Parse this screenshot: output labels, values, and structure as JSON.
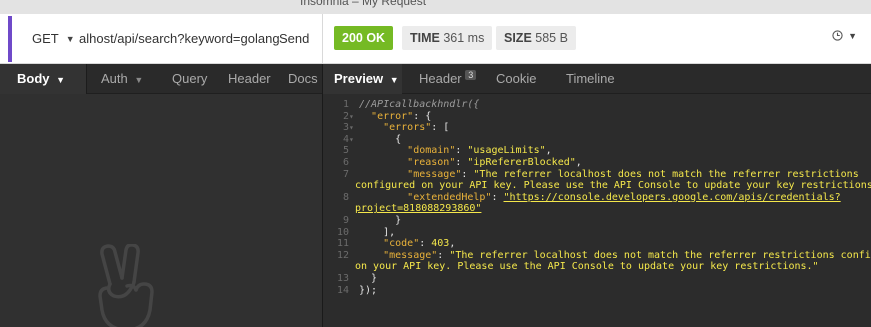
{
  "window": {
    "title": "Insomnia – My Request"
  },
  "request": {
    "method": "GET",
    "url": "alhost/api/search?keyword=golang",
    "send_label": "Send"
  },
  "response": {
    "status": "200 OK",
    "time_label": "TIME",
    "time_value": "361 ms",
    "size_label": "SIZE",
    "size_value": "585 B",
    "history_icon": "clock-icon"
  },
  "request_tabs": [
    "Body",
    "Auth",
    "Query",
    "Header",
    "Docs"
  ],
  "response_tabs": {
    "preview": "Preview",
    "header": "Header",
    "header_count": "3",
    "cookie": "Cookie",
    "timeline": "Timeline"
  },
  "code": {
    "line_numbers": [
      "1",
      "2",
      "3",
      "4",
      "5",
      "6",
      "7",
      "8",
      "9",
      "10",
      "11",
      "12",
      "13",
      "14"
    ],
    "comment": "//APIcallbackhndlr({",
    "k_error": "\"error\"",
    "k_errors": "\"errors\"",
    "k_domain": "\"domain\"",
    "v_domain": "\"usageLimits\"",
    "k_reason": "\"reason\"",
    "v_reason": "\"ipRefererBlocked\"",
    "k_message": "\"message\"",
    "v_message_1": "\"The referrer localhost does not match the referrer restrictions",
    "v_message_2": "configured on your API key. Please use the API Console to update your key restrictions.\"",
    "k_help": "\"extendedHelp\"",
    "v_help_1": "\"https://console.developers.google.com/apis/credentials?",
    "v_help_2": "project=818088293860\"",
    "k_code": "\"code\"",
    "v_code": "403",
    "k_message2": "\"message\"",
    "v_message2_1": "\"The referrer localhost does not match the referrer restrictions configured",
    "v_message2_2": "on your API key. Please use the API Console to update your key restrictions.\"",
    "close": "});"
  },
  "colors": {
    "accent": "#6f4ac9",
    "status_ok": "#75ba24",
    "json_key": "#e9b23a",
    "json_string": "#f5e84b"
  }
}
